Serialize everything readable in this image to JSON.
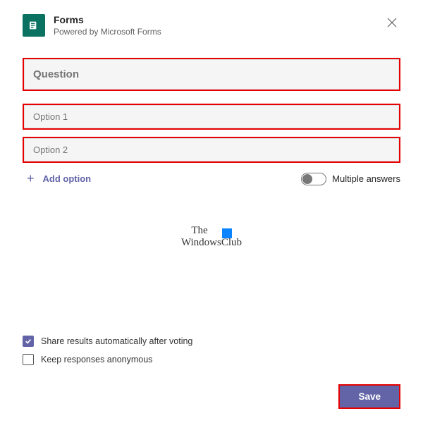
{
  "header": {
    "title": "Forms",
    "subtitle": "Powered by Microsoft Forms"
  },
  "question": {
    "placeholder": "Question"
  },
  "options": [
    {
      "placeholder": "Option 1"
    },
    {
      "placeholder": "Option 2"
    }
  ],
  "add_option_label": "Add option",
  "multiple_answers_label": "Multiple answers",
  "watermark": {
    "line1": "The",
    "line2": "WindowsClub"
  },
  "checks": {
    "share_results": {
      "label": "Share results automatically after voting",
      "checked": true
    },
    "anonymous": {
      "label": "Keep responses anonymous",
      "checked": false
    }
  },
  "save_label": "Save"
}
